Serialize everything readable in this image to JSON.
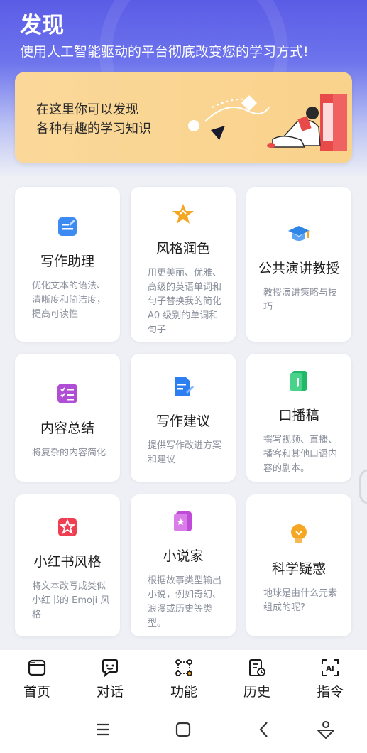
{
  "header": {
    "title": "发现",
    "subtitle": "使用人工智能驱动的平台彻底改变您的学习方式!"
  },
  "banner": {
    "line1": "在这里你可以发现",
    "line2": "各种有趣的学习知识"
  },
  "cards": [
    {
      "title": "写作助理",
      "desc": "优化文本的语法、清晰度和简洁度，提高可读性",
      "icon": "edit-doc-icon",
      "color": "#3d8bf2"
    },
    {
      "title": "风格润色",
      "desc": "用更美丽、优雅、高级的英语单词和句子替换我的简化A0 级别的单词和句子",
      "icon": "star-icon",
      "color": "#f5a623"
    },
    {
      "title": "公共演讲教授",
      "desc": "教授演讲策略与技巧",
      "icon": "graduation-cap-icon",
      "color": "#2f86e8"
    },
    {
      "title": "内容总结",
      "desc": "将复杂的内容简化",
      "icon": "checklist-icon",
      "color": "#b04fd6"
    },
    {
      "title": "写作建议",
      "desc": "提供写作改进方案和建议",
      "icon": "document-pen-icon",
      "color": "#2d7ef0"
    },
    {
      "title": "口播稿",
      "desc": "撰写视频、直播、播客和其他口语内容的剧本。",
      "icon": "script-icon",
      "color": "#22b86a"
    },
    {
      "title": "小红书风格",
      "desc": "将文本改写成类似小红书的 Emoji 风格",
      "icon": "badge-star-icon",
      "color": "#ef3d52"
    },
    {
      "title": "小说家",
      "desc": "根据故事类型输出小说，例如奇幻、浪漫或历史等类型。",
      "icon": "book-icon",
      "color": "#c04bd8"
    },
    {
      "title": "科学疑惑",
      "desc": "地球是由什么元素组成的呢?",
      "icon": "lightbulb-icon",
      "color": "#f5a623"
    }
  ],
  "tabs": [
    {
      "label": "首页",
      "icon": "home-icon"
    },
    {
      "label": "对话",
      "icon": "chat-icon"
    },
    {
      "label": "功能",
      "icon": "function-icon"
    },
    {
      "label": "历史",
      "icon": "history-icon"
    },
    {
      "label": "指令",
      "icon": "ai-icon",
      "glyph": "AI"
    }
  ],
  "system_nav": {
    "menu": "menu-icon",
    "home": "home-square-icon",
    "back": "back-icon",
    "assistant": "assistant-icon"
  }
}
